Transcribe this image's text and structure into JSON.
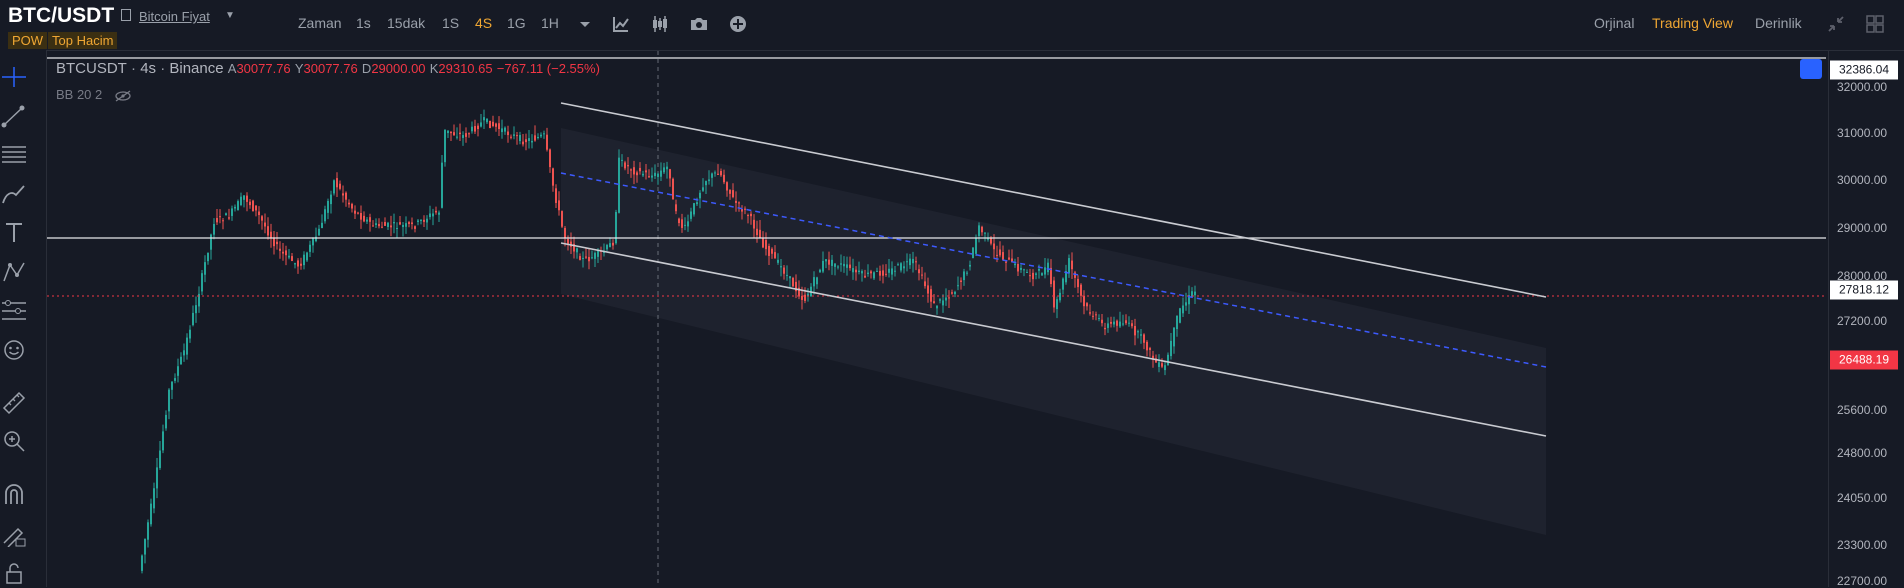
{
  "header": {
    "pair": "BTC/USDT",
    "subtitle": "Bitcoin Fiyat",
    "tags": [
      "POW",
      "Top Hacim"
    ],
    "timeframes": [
      {
        "label": "Zaman",
        "active": false
      },
      {
        "label": "1s",
        "active": false
      },
      {
        "label": "15dak",
        "active": false
      },
      {
        "label": "1S",
        "active": false
      },
      {
        "label": "4S",
        "active": true
      },
      {
        "label": "1G",
        "active": false
      },
      {
        "label": "1H",
        "active": false
      }
    ],
    "tools": [
      "caret-down-icon",
      "indicator-icon",
      "candles-icon",
      "camera-icon",
      "plus-circle-icon"
    ],
    "right_tabs": [
      {
        "label": "Orjinal",
        "active": false
      },
      {
        "label": "Trading View",
        "active": true
      },
      {
        "label": "Derinlik",
        "active": false
      }
    ],
    "right_icons": [
      "collapse-icon",
      "layout-grid-icon"
    ]
  },
  "sidebar": {
    "tools": [
      "crosshair-icon",
      "trend-line-icon",
      "fib-lines-icon",
      "brush-icon",
      "text-icon",
      "pattern-icon",
      "prediction-icon",
      "emoji-icon",
      "ruler-icon",
      "zoom-in-icon",
      "magnet-icon",
      "lock-drawing-icon",
      "lock-icon"
    ]
  },
  "legend": {
    "symbol": "BTCUSDT",
    "interval": "4s",
    "exchange": "Binance",
    "open_label": "A",
    "open": "30077.76",
    "high_label": "Y",
    "high": "30077.76",
    "low_label": "D",
    "low": "29000.00",
    "close_label": "K",
    "close": "29310.65",
    "change": "−767.11 (−2.55%)",
    "indicator": "BB 20 2"
  },
  "colors": {
    "background": "#161a25",
    "up": "#26a69a",
    "down": "#ef5350",
    "accent": "#f0a733",
    "channel": "#c9cbd1",
    "midline": "#3d5afe",
    "last_price": "#f23645"
  },
  "price_axis": {
    "ticks": [
      "32000.00",
      "31000.00",
      "30000.00",
      "29000.00",
      "28000.00",
      "27200.00",
      "25600.00",
      "24800.00",
      "24050.00",
      "23300.00",
      "22700.00"
    ],
    "labels": [
      {
        "value": "32386.04",
        "style": "white"
      },
      {
        "value": "27818.12",
        "style": "white"
      },
      {
        "value": "26488.19",
        "style": "red"
      }
    ]
  }
}
